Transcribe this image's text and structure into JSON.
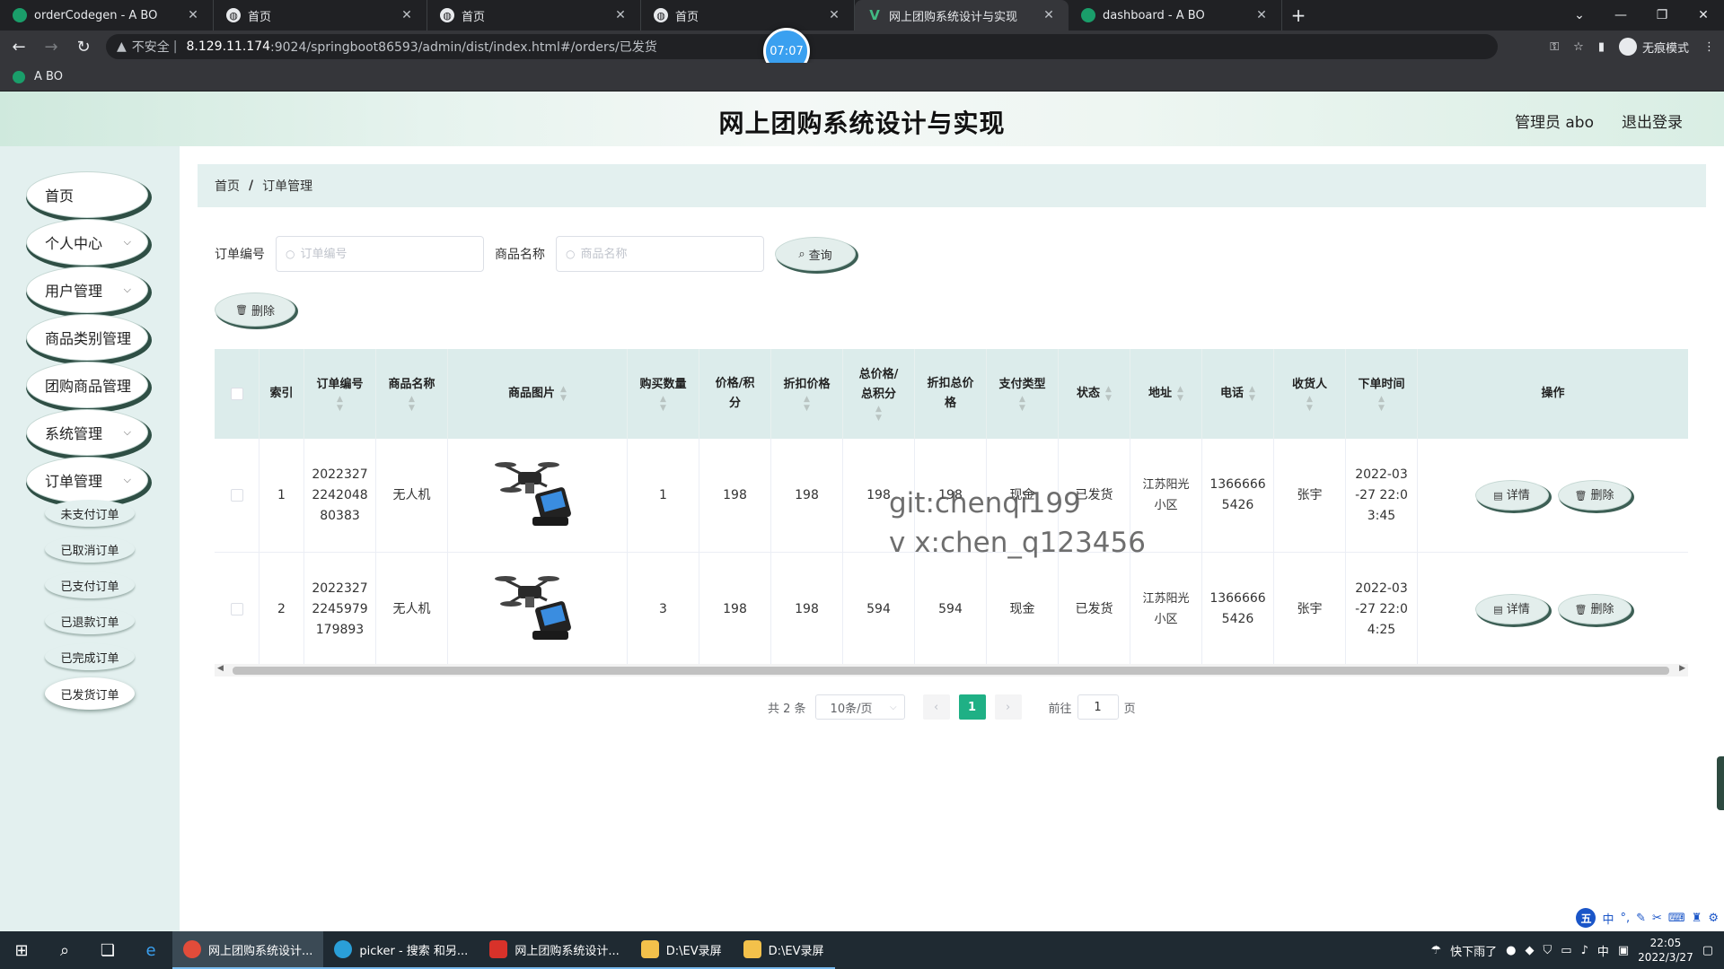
{
  "browser": {
    "tabs": [
      {
        "title": "orderCodegen - A BO",
        "icon": "green-dot-icon"
      },
      {
        "title": "首页",
        "icon": "globe-icon"
      },
      {
        "title": "首页",
        "icon": "globe-icon"
      },
      {
        "title": "首页",
        "icon": "globe-icon"
      },
      {
        "title": "网上团购系统设计与实现",
        "icon": "vue-icon",
        "active": true
      },
      {
        "title": "dashboard - A BO",
        "icon": "green-dot-icon"
      }
    ],
    "address": {
      "security": "不安全",
      "host": "8.129.11.174",
      "rest": ":9024/springboot86593/admin/dist/index.html#/orders/已发货"
    },
    "recording_time": "07:07",
    "incognito_label": "无痕模式",
    "bookmark": "A BO"
  },
  "header": {
    "title": "网上团购系统设计与实现",
    "admin_label": "管理员 abo",
    "logout_label": "退出登录"
  },
  "sidebar": {
    "items": [
      {
        "label": "首页",
        "has_children": false
      },
      {
        "label": "个人中心",
        "has_children": true
      },
      {
        "label": "用户管理",
        "has_children": true
      },
      {
        "label": "商品类别管理",
        "has_children": false
      },
      {
        "label": "团购商品管理",
        "has_children": false
      },
      {
        "label": "系统管理",
        "has_children": true
      },
      {
        "label": "订单管理",
        "has_children": true
      }
    ],
    "sub_items": [
      "未支付订单",
      "已取消订单",
      "已支付订单",
      "已退款订单",
      "已完成订单",
      "已发货订单"
    ],
    "active_sub": "已发货订单"
  },
  "breadcrumb": {
    "home": "首页",
    "sep": "/",
    "current": "订单管理"
  },
  "search": {
    "order_no_label": "订单编号",
    "order_no_placeholder": "订单编号",
    "product_label": "商品名称",
    "product_placeholder": "商品名称",
    "query_label": "查询",
    "delete_label": "删除"
  },
  "table": {
    "headers": [
      "索引",
      "订单编号",
      "商品名称",
      "商品图片",
      "购买数量",
      "价格/积\n分",
      "折扣价格",
      "总价格/\n总积分",
      "折扣总价\n格",
      "支付类型",
      "状态",
      "地址",
      "电话",
      "收货人",
      "下单时间",
      "操作"
    ],
    "rows": [
      {
        "index": "1",
        "order_no": "2022327\n2242048\n80383",
        "product": "无人机",
        "qty": "1",
        "price": "198",
        "discount_price": "198",
        "total": "198",
        "discount_total": "198",
        "pay_type": "现金",
        "status": "已发货",
        "address": "江苏阳光\n小区",
        "phone": "1366666\n5426",
        "receiver": "张宇",
        "time": "2022-03\n-27 22:0\n3:45"
      },
      {
        "index": "2",
        "order_no": "2022327\n2245979\n179893",
        "product": "无人机",
        "qty": "3",
        "price": "198",
        "discount_price": "198",
        "total": "594",
        "discount_total": "594",
        "pay_type": "现金",
        "status": "已发货",
        "address": "江苏阳光\n小区",
        "phone": "1366666\n5426",
        "receiver": "张宇",
        "time": "2022-03\n-27 22:0\n4:25"
      }
    ],
    "detail_label": "详情",
    "delete_label": "删除"
  },
  "watermark": {
    "line1": "git:chenqi199",
    "line2": "v x:chen_q123456"
  },
  "pagination": {
    "total": "共 2 条",
    "page_size": "10条/页",
    "current_page": "1",
    "goto_label": "前往",
    "goto_value": "1",
    "page_unit": "页"
  },
  "taskbar": {
    "apps": [
      {
        "label": "网上团购系统设计...",
        "active": true
      },
      {
        "label": "picker - 搜索 和另...",
        "active": false
      },
      {
        "label": "网上团购系统设计...",
        "active": false
      },
      {
        "label": "D:\\EV录屏",
        "active": false
      },
      {
        "label": "D:\\EV录屏",
        "active": false
      }
    ],
    "weather": "快下雨了",
    "ime": "中",
    "time": "22:05",
    "date": "2022/3/27"
  },
  "colors": {
    "accent": "#1fb085",
    "sidebar_bg": "#e3f0ef",
    "table_head_bg": "#dceceb"
  }
}
